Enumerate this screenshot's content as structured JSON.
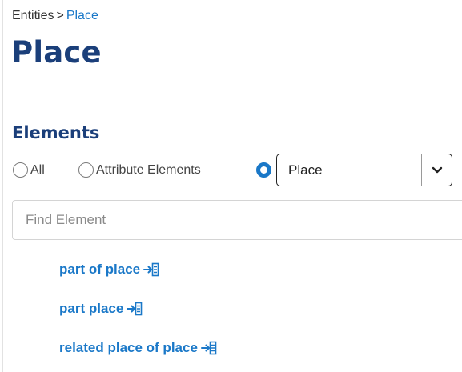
{
  "breadcrumb": {
    "root": "Entities",
    "separator": ">",
    "current": "Place"
  },
  "page_title": "Place",
  "elements_section": {
    "title": "Elements",
    "filters": [
      {
        "label": "All",
        "checked": false
      },
      {
        "label": "Attribute Elements",
        "checked": false
      },
      {
        "label": "",
        "checked": true
      }
    ],
    "select": {
      "value": "Place",
      "icon": "chevron-down-icon"
    },
    "search": {
      "placeholder": "Find Element",
      "value": ""
    },
    "items": [
      {
        "label": "part of place",
        "icon": "insert-into-list-icon"
      },
      {
        "label": "part place",
        "icon": "insert-into-list-icon"
      },
      {
        "label": "related place of place",
        "icon": "insert-into-list-icon"
      }
    ]
  },
  "colors": {
    "title": "#1b3f7a",
    "link": "#1a78c8",
    "text": "#333333",
    "border": "#d4d4d4"
  }
}
